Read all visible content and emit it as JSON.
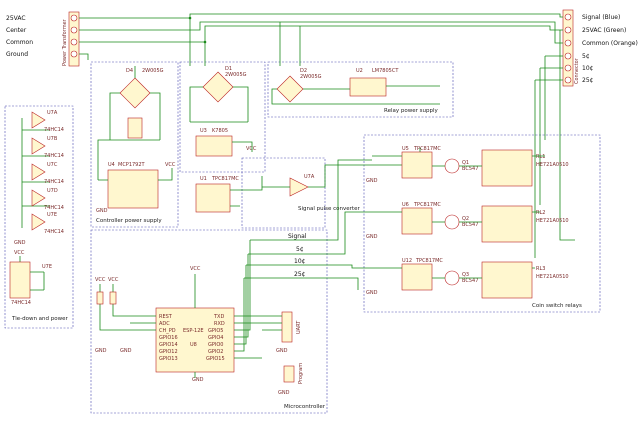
{
  "terminal_left": {
    "labels": [
      "25VAC",
      "Center",
      "Common",
      "Ground"
    ],
    "ref": "Power Transformer"
  },
  "terminal_right": {
    "labels": [
      "Signal (Blue)",
      "25VAC (Green)",
      "Common (Orange)",
      "5¢",
      "10¢",
      "25¢"
    ],
    "ref": "Connector"
  },
  "blocks": {
    "tie_down": "Tie-down and power",
    "controller_power": "Controller power supply",
    "relay_power": "Relay power supply",
    "signal_pulse": "Signal pulse converter",
    "coin_relays": "Coin switch relays",
    "microcontroller": "Microcontroller"
  },
  "nets": {
    "signal": "Signal",
    "n5": "5¢",
    "n10": "10¢",
    "n25": "25¢"
  },
  "parts": {
    "u7": "U7A",
    "u8": "U7B",
    "u9": "U7C",
    "u10": "U7D",
    "u11": "U7E",
    "inv": "74HC14",
    "d4": "D4",
    "d4v": "2W005G",
    "d1": "D1",
    "d1v": "2W005G",
    "d2": "D2",
    "d2v": "2W005G",
    "u1": "U1",
    "u1v": "LM7805CT",
    "u2": "U2",
    "u2v": "LM7805CT",
    "u3": "U3",
    "u3v": "K7805",
    "u4": "U4",
    "u4v": "MCP1792T",
    "u5": "U5",
    "u5v": "TPC817MC",
    "u6": "U6",
    "u6v": "TPC817MC",
    "u12": "U12",
    "u12v": "TPC817MC",
    "q1": "Q1",
    "q2": "Q2",
    "q3": "Q3",
    "qv": "BC547",
    "rl1": "RL1",
    "rl2": "RL2",
    "rl3": "RL3",
    "rlv": "HE721A0510",
    "u13": "U13",
    "u13v": "ESP-12E",
    "esp_left": [
      "REST",
      "ADC",
      "CH_PD",
      "GPIO16",
      "GPIO14",
      "GPIO12",
      "GPIO13"
    ],
    "esp_right": [
      "TXD",
      "RXD",
      "GPIO5",
      "GPIO4",
      "GPIO0",
      "GPIO2",
      "GPIO15"
    ],
    "esp_mid": "U8",
    "vcc": "VCC",
    "gnd": "GND",
    "j_uart": "UART",
    "j_prog": "Program"
  },
  "colors": {
    "wire": "#1a8a1a",
    "component": "#b22222",
    "box": "#4a4ab0",
    "body_fill": "#fff7cf"
  }
}
